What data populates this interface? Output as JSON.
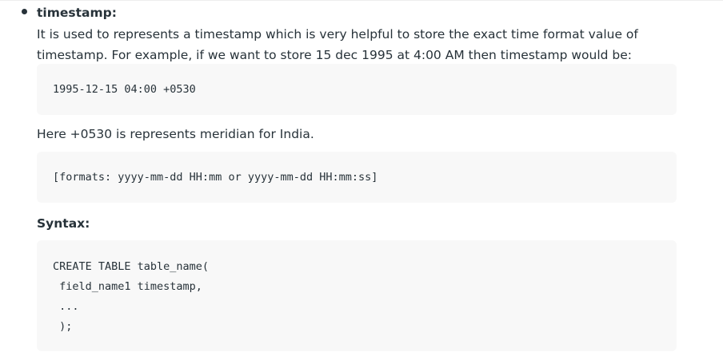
{
  "item": {
    "term": "timestamp:",
    "description_line1": "It is used to represents a timestamp which is very helpful to store the exact time format value of",
    "description_line2": "timestamp. For example, if we want to store 15 dec 1995 at 4:00 AM then timestamp would be:"
  },
  "example_code": "1995-12-15 04:00 +0530",
  "note": "Here +0530 is represents meridian for India.",
  "formats_code": "[formats: yyyy-mm-dd HH:mm or yyyy-mm-dd HH:mm:ss]",
  "syntax": {
    "heading": "Syntax:",
    "lines": [
      "CREATE TABLE table_name(",
      " field_name1 timestamp,",
      " ...",
      " );"
    ]
  }
}
